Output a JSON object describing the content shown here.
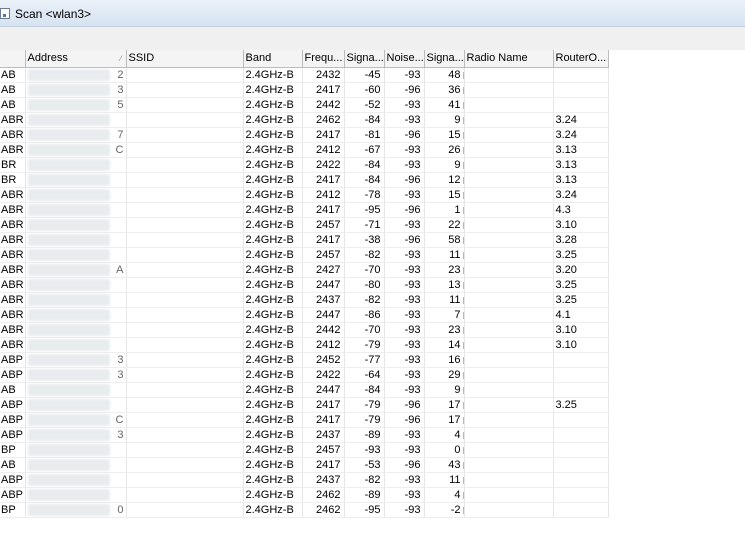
{
  "window": {
    "title": "Scan <wlan3>"
  },
  "columns": [
    "",
    "Address",
    "SSID",
    "Band",
    "Frequ...",
    "Signa...",
    "Noise...",
    "Signa...",
    "Radio Name",
    "RouterO..."
  ],
  "sort_indicator": "∕",
  "rows": [
    {
      "flags": "AB",
      "addr": "2",
      "band": "2.4GHz-B",
      "freq": "2432",
      "signal": "-45",
      "noise": "-93",
      "snr": "48",
      "router": ""
    },
    {
      "flags": "AB",
      "addr": "3",
      "band": "2.4GHz-B",
      "freq": "2417",
      "signal": "-60",
      "noise": "-96",
      "snr": "36",
      "router": ""
    },
    {
      "flags": "AB",
      "addr": "5",
      "band": "2.4GHz-B",
      "freq": "2442",
      "signal": "-52",
      "noise": "-93",
      "snr": "41",
      "router": ""
    },
    {
      "flags": "ABR",
      "addr": "",
      "band": "2.4GHz-B",
      "freq": "2462",
      "signal": "-84",
      "noise": "-93",
      "snr": "9",
      "router": "3.24"
    },
    {
      "flags": "ABR",
      "addr": "7",
      "band": "2.4GHz-B",
      "freq": "2417",
      "signal": "-81",
      "noise": "-96",
      "snr": "15",
      "router": "3.24"
    },
    {
      "flags": "ABR",
      "addr": "C",
      "band": "2.4GHz-B",
      "freq": "2412",
      "signal": "-67",
      "noise": "-93",
      "snr": "26",
      "router": "3.13"
    },
    {
      "flags": "BR",
      "addr": "",
      "band": "2.4GHz-B",
      "freq": "2422",
      "signal": "-84",
      "noise": "-93",
      "snr": "9",
      "router": "3.13"
    },
    {
      "flags": "BR",
      "addr": "",
      "band": "2.4GHz-B",
      "freq": "2417",
      "signal": "-84",
      "noise": "-96",
      "snr": "12",
      "router": "3.13"
    },
    {
      "flags": "ABR",
      "addr": "",
      "band": "2.4GHz-B",
      "freq": "2412",
      "signal": "-78",
      "noise": "-93",
      "snr": "15",
      "router": "3.24"
    },
    {
      "flags": "ABR",
      "addr": "",
      "band": "2.4GHz-B",
      "freq": "2417",
      "signal": "-95",
      "noise": "-96",
      "snr": "1",
      "router": "4.3"
    },
    {
      "flags": "ABR",
      "addr": "",
      "band": "2.4GHz-B",
      "freq": "2457",
      "signal": "-71",
      "noise": "-93",
      "snr": "22",
      "router": "3.10"
    },
    {
      "flags": "ABR",
      "addr": "",
      "band": "2.4GHz-B",
      "freq": "2417",
      "signal": "-38",
      "noise": "-96",
      "snr": "58",
      "router": "3.28"
    },
    {
      "flags": "ABR",
      "addr": "",
      "band": "2.4GHz-B",
      "freq": "2457",
      "signal": "-82",
      "noise": "-93",
      "snr": "11",
      "router": "3.25"
    },
    {
      "flags": "ABR",
      "addr": "A",
      "band": "2.4GHz-B",
      "freq": "2427",
      "signal": "-70",
      "noise": "-93",
      "snr": "23",
      "router": "3.20"
    },
    {
      "flags": "ABR",
      "addr": "",
      "band": "2.4GHz-B",
      "freq": "2447",
      "signal": "-80",
      "noise": "-93",
      "snr": "13",
      "router": "3.25"
    },
    {
      "flags": "ABR",
      "addr": "",
      "band": "2.4GHz-B",
      "freq": "2437",
      "signal": "-82",
      "noise": "-93",
      "snr": "11",
      "router": "3.25"
    },
    {
      "flags": "ABR",
      "addr": "",
      "band": "2.4GHz-B",
      "freq": "2447",
      "signal": "-86",
      "noise": "-93",
      "snr": "7",
      "router": "4.1"
    },
    {
      "flags": "ABR",
      "addr": "",
      "band": "2.4GHz-B",
      "freq": "2442",
      "signal": "-70",
      "noise": "-93",
      "snr": "23",
      "router": "3.10"
    },
    {
      "flags": "ABR",
      "addr": "",
      "band": "2.4GHz-B",
      "freq": "2412",
      "signal": "-79",
      "noise": "-93",
      "snr": "14",
      "router": "3.10"
    },
    {
      "flags": "ABP",
      "addr": "3",
      "band": "2.4GHz-B",
      "freq": "2452",
      "signal": "-77",
      "noise": "-93",
      "snr": "16",
      "router": ""
    },
    {
      "flags": "ABP",
      "addr": "3",
      "band": "2.4GHz-B",
      "freq": "2422",
      "signal": "-64",
      "noise": "-93",
      "snr": "29",
      "router": ""
    },
    {
      "flags": "AB",
      "addr": "",
      "band": "2.4GHz-B",
      "freq": "2447",
      "signal": "-84",
      "noise": "-93",
      "snr": "9",
      "router": ""
    },
    {
      "flags": "ABP",
      "addr": "",
      "band": "2.4GHz-B",
      "freq": "2417",
      "signal": "-79",
      "noise": "-96",
      "snr": "17",
      "router": "3.25"
    },
    {
      "flags": "ABP",
      "addr": "C",
      "band": "2.4GHz-B",
      "freq": "2417",
      "signal": "-79",
      "noise": "-96",
      "snr": "17",
      "router": ""
    },
    {
      "flags": "ABP",
      "addr": "3",
      "band": "2.4GHz-B",
      "freq": "2437",
      "signal": "-89",
      "noise": "-93",
      "snr": "4",
      "router": ""
    },
    {
      "flags": "BP",
      "addr": "",
      "band": "2.4GHz-B",
      "freq": "2457",
      "signal": "-93",
      "noise": "-93",
      "snr": "0",
      "router": ""
    },
    {
      "flags": "AB",
      "addr": "",
      "band": "2.4GHz-B",
      "freq": "2417",
      "signal": "-53",
      "noise": "-96",
      "snr": "43",
      "router": ""
    },
    {
      "flags": "ABP",
      "addr": "",
      "band": "2.4GHz-B",
      "freq": "2437",
      "signal": "-82",
      "noise": "-93",
      "snr": "11",
      "router": ""
    },
    {
      "flags": "ABP",
      "addr": "",
      "band": "2.4GHz-B",
      "freq": "2462",
      "signal": "-89",
      "noise": "-93",
      "snr": "4",
      "router": ""
    },
    {
      "flags": "BP",
      "addr": "0",
      "band": "2.4GHz-B",
      "freq": "2462",
      "signal": "-95",
      "noise": "-93",
      "snr": "-2",
      "router": ""
    }
  ]
}
